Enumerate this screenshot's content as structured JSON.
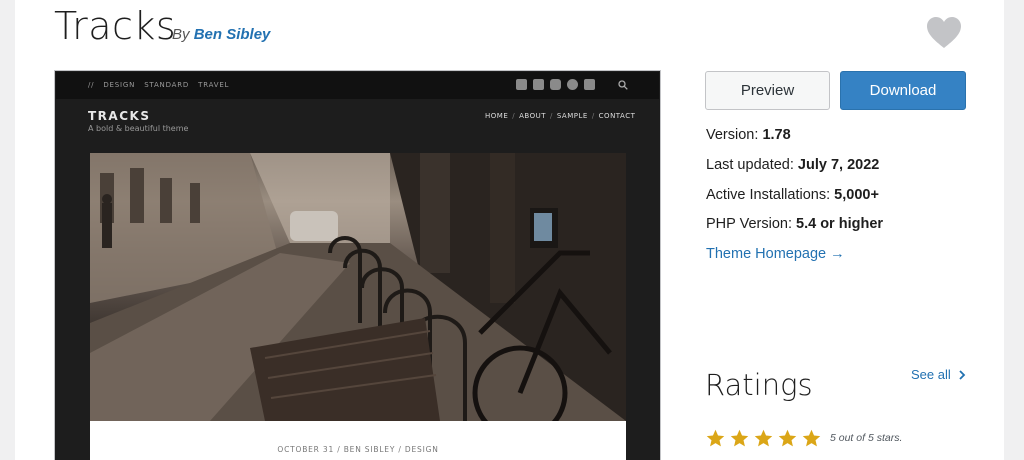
{
  "theme": {
    "title": "Tracks",
    "by_prefix": "By",
    "author": "Ben Sibley"
  },
  "screenshot": {
    "topbar_menu": [
      "//",
      "DESIGN",
      "STANDARD",
      "TRAVEL"
    ],
    "social_icons": [
      "twitter-icon",
      "facebook-icon",
      "instagram-icon",
      "pinterest-icon",
      "rss-icon"
    ],
    "brand": "TRACKS",
    "tagline": "A bold & beautiful theme",
    "nav": [
      "HOME",
      "ABOUT",
      "SAMPLE",
      "CONTACT"
    ],
    "nav_separator": "/",
    "post_meta": "OCTOBER 31 / BEN SIBLEY / DESIGN"
  },
  "actions": {
    "preview_label": "Preview",
    "download_label": "Download"
  },
  "details": {
    "version_label": "Version:",
    "version_value": "1.78",
    "updated_label": "Last updated:",
    "updated_value": "July 7, 2022",
    "installs_label": "Active Installations:",
    "installs_value": "5,000+",
    "php_label": "PHP Version:",
    "php_value": "5.4 or higher",
    "homepage_link": "Theme Homepage →"
  },
  "ratings": {
    "heading": "Ratings",
    "see_all": "See all",
    "stars": 5,
    "summary": "5 out of 5 stars."
  },
  "colors": {
    "link": "#2271b1",
    "download_bg": "#3582c4",
    "star": "#dba617"
  }
}
